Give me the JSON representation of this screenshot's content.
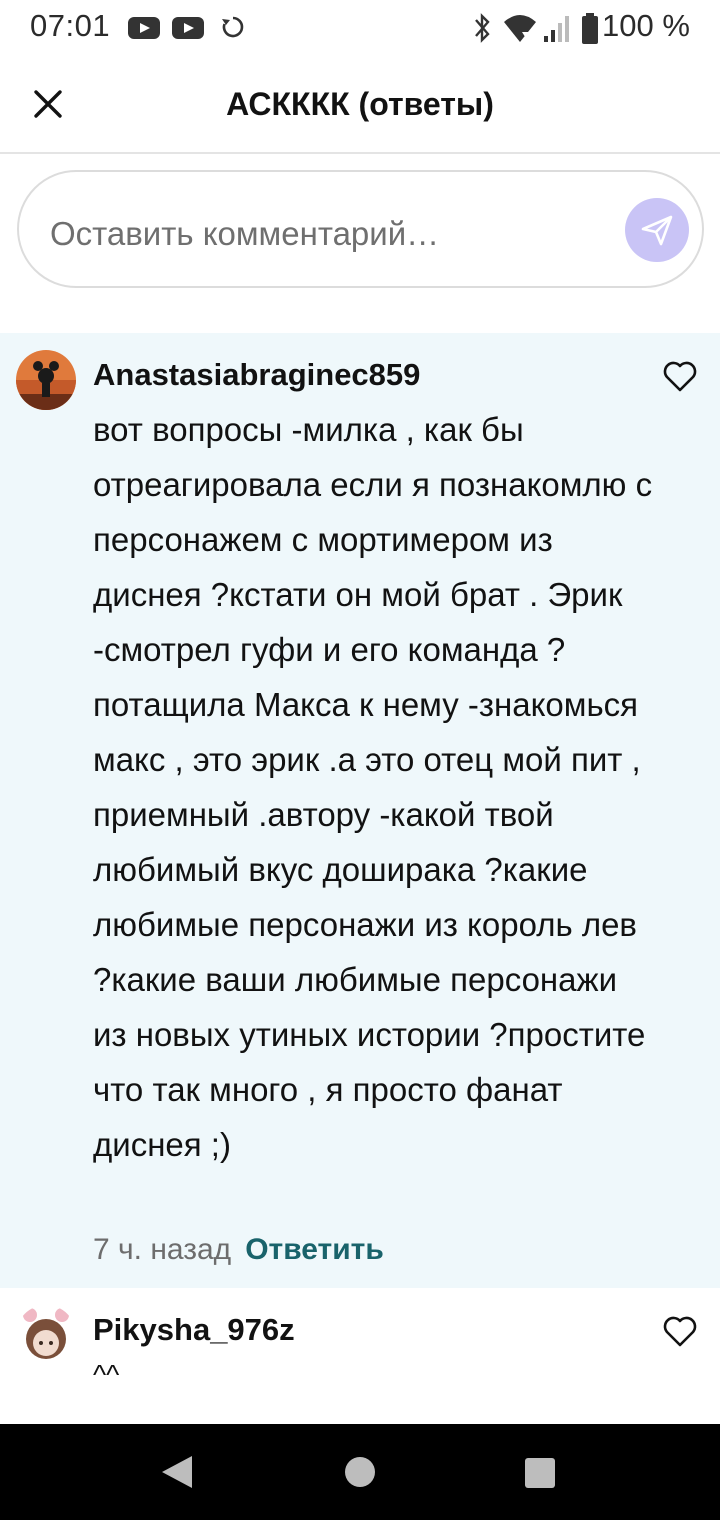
{
  "status_bar": {
    "time": "07:01",
    "battery": "100 %",
    "icons": [
      "youtube-icon",
      "youtube-icon",
      "sync-icon",
      "bluetooth-icon",
      "wifi-icon",
      "signal-icon",
      "battery-icon"
    ]
  },
  "header": {
    "title": "АСКККК (ответы)",
    "close_icon": "close-icon"
  },
  "comment_input": {
    "placeholder": "Оставить комментарий…",
    "send_icon": "send-icon",
    "send_color": "#c9c4f6"
  },
  "comments": [
    {
      "username": "Anastasiabraginec859",
      "text": "вот вопросы -милка , как бы отреагировала если я познакомлю с персонажем с мортимером из диснея ?кстати он мой брат . Эрик -смотрел гуфи и его команда ?потащила Макса к нему -знакомься макс , это эрик .а это отец мой пит , приемный .автору -какой твой любимый вкус доширака ?какие любимые персонажи из король лев ?какие ваши любимые персонажи из новых утиных истории ?простите что так много , я просто фанат диснея ;)",
      "time_ago": "7 ч. назад",
      "reply_label": "Ответить",
      "highlighted": true
    },
    {
      "username": "Pikysha_976z",
      "text": "^^"
    }
  ],
  "colors": {
    "highlight_bg": "#eff8fb",
    "reply_color": "#19636b",
    "accent": "#c9c4f6"
  }
}
